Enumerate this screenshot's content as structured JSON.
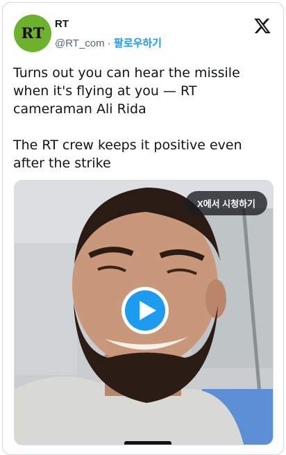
{
  "author": {
    "name": "RT",
    "handle": "@RT_com",
    "separator": " · ",
    "follow_label": "팔로우하기",
    "avatar_text": "RT"
  },
  "tweet": {
    "line1": "Turns out you can hear the missile when it's flying at you — RT cameraman Ali Rida",
    "line2": "The RT crew keeps it positive even after the strike"
  },
  "media": {
    "watch_label": "X에서 시청하기"
  },
  "colors": {
    "brand_green": "#6cb22d",
    "link_blue": "#1d9bf0",
    "play_blue": "#1d9bf0",
    "text": "#0f1419",
    "muted": "#536471"
  },
  "icons": {
    "platform": "x-logo-icon",
    "play": "play-icon"
  }
}
